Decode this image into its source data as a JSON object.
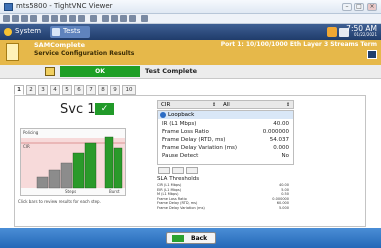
{
  "window": {
    "title": "mts5800 - TightVNC Viewer"
  },
  "appbar": {
    "tab_system": "System",
    "tab_tests": "Tests",
    "time": "7:50 AM",
    "date": "01/22/2021"
  },
  "header": {
    "test_name": "SAMComplete",
    "port_info": "Port 1: 10/100/1000 Eth Layer 3 Streams Term",
    "subtitle": "Service Configuration Results"
  },
  "status": {
    "result": "OK",
    "message": "Test Complete"
  },
  "service_tabs": [
    "1",
    "2",
    "3",
    "4",
    "5",
    "6",
    "7",
    "8",
    "9",
    "10"
  ],
  "active_tab": "1",
  "service": {
    "label": "Svc 1",
    "check_glyph": "✓"
  },
  "chart": {
    "label_policing": "Policing",
    "label_cir": "CIR",
    "label_steps": "Steps",
    "label_burst": "Burst"
  },
  "table": {
    "metric_select": "CIR",
    "scope_select": "All",
    "loopback_label": "Loopback",
    "rows": [
      {
        "label": "IR (L1 Mbps)",
        "value": "40.00"
      },
      {
        "label": "Frame Loss Ratio",
        "value": "0.000000"
      },
      {
        "label": "Frame Delay (RTD, ms)",
        "value": "54.037"
      },
      {
        "label": "Frame Delay Variation (ms)",
        "value": "0.000"
      },
      {
        "label": "Pause Detect",
        "value": "No"
      }
    ]
  },
  "thresholds": {
    "title": "SLA Thresholds",
    "rows": [
      {
        "label": "CIR (L1 Mbps)",
        "value": "40.00"
      },
      {
        "label": "EIR (L1 Mbps)",
        "value": "5.00"
      },
      {
        "label": "M (L1 Mbps)",
        "value": "0.50"
      },
      {
        "label": "Frame Loss Ratio",
        "value": "0.000000"
      },
      {
        "label": "Frame Delay (RTD, ms)",
        "value": "60.000"
      },
      {
        "label": "Frame Delay Variation (ms)",
        "value": "5.000"
      }
    ]
  },
  "hint": "Click bars to review results for each step.",
  "back": "Back",
  "colors": {
    "gold": "#e6b84a",
    "ok_green": "#1e9f26",
    "bar_gray": "#8c8c8c",
    "bar_green": "#2a9a2a"
  }
}
